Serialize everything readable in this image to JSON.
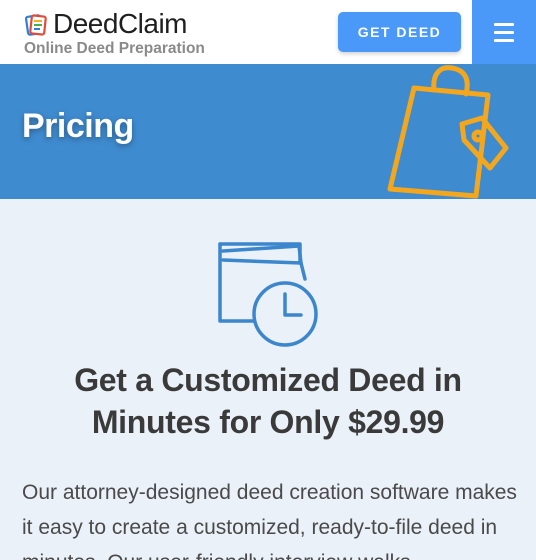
{
  "header": {
    "brand_name": "DeedClaim",
    "tagline": "Online Deed Preparation",
    "cta_label": "GET DEED",
    "menu_icon": "hamburger-icon",
    "logo_icon": "document-stack-logo-icon"
  },
  "banner": {
    "title": "Pricing",
    "icon": "shopping-bag-tag-icon"
  },
  "main": {
    "icon": "wallet-clock-icon",
    "headline_line1": "Get a Customized Deed in",
    "headline_line2": "Minutes for Only $29.99",
    "description": "Our attorney-designed deed creation software makes it easy to create a customized, ready-to-file deed in minutes. Our user-friendly interview walks"
  },
  "colors": {
    "accent_blue": "#4a98f7",
    "banner_blue": "#3f8bd0",
    "bag_orange": "#f4a71d",
    "icon_blue": "#3b86cc",
    "page_background": "#eaf1f8",
    "heading_text": "#3a3a3a",
    "tagline_gray": "#8a8a8a"
  }
}
